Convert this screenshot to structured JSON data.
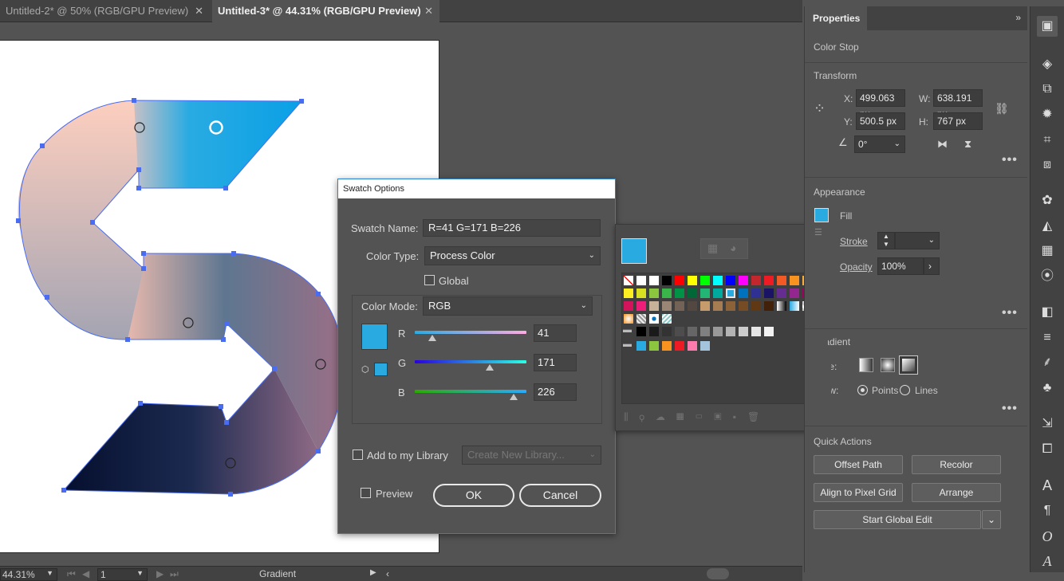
{
  "tabs": [
    {
      "label": "Untitled-2* @ 50% (RGB/GPU Preview)",
      "close": "✕"
    },
    {
      "label": "Untitled-3* @ 44.31% (RGB/GPU Preview)",
      "close": "✕"
    }
  ],
  "status": {
    "zoom": "44.31%",
    "artboard": "1",
    "tool_label": "Gradient"
  },
  "dialog": {
    "title": "Swatch Options",
    "swatch_name_label": "Swatch Name:",
    "swatch_name_value": "R=41 G=171 B=226",
    "color_type_label": "Color Type:",
    "color_type_value": "Process Color",
    "global_label": "Global",
    "color_mode_label": "Color Mode:",
    "color_mode_value": "RGB",
    "r_label": "R",
    "g_label": "G",
    "b_label": "B",
    "r_value": "41",
    "g_value": "171",
    "b_value": "226",
    "add_library_label": "Add to my Library",
    "library_placeholder": "Create New Library...",
    "preview_label": "Preview",
    "ok_label": "OK",
    "cancel_label": "Cancel",
    "swatch_color": "#29abe2"
  },
  "properties": {
    "tab_label": "Properties",
    "context": "Color Stop",
    "transform": {
      "title": "Transform",
      "x_label": "X:",
      "x_value": "499.063 px",
      "y_label": "Y:",
      "y_value": "500.5 px",
      "w_label": "W:",
      "w_value": "638.191 px",
      "h_label": "H:",
      "h_value": "767 px",
      "angle_value": "0°"
    },
    "appearance": {
      "title": "Appearance",
      "fill_label": "Fill",
      "stroke_label": "Stroke",
      "opacity_label": "Opacity",
      "opacity_value": "100%"
    },
    "gradient": {
      "title": "Gradient",
      "type_label": "Type:",
      "draw_label": "Draw:",
      "points_label": "Points",
      "lines_label": "Lines"
    },
    "quick_actions": {
      "title": "Quick Actions",
      "offset_path": "Offset Path",
      "recolor": "Recolor",
      "align_pixel": "Align to Pixel Grid",
      "arrange": "Arrange",
      "global_edit": "Start Global Edit"
    }
  },
  "icons": [
    "properties-icon",
    "layers-icon",
    "libraries-icon",
    "appearance-icon",
    "transform-icon",
    "pathfinder-icon",
    "color-guide-icon",
    "color-icon",
    "swatches-icon",
    "recolor-icon",
    "gradient-icon",
    "stroke-icon",
    "brushes-icon",
    "symbols-icon",
    "asset-export-icon",
    "artboards-icon",
    "character-icon",
    "paragraph-icon",
    "opentype-icon",
    "glyphs-icon"
  ],
  "swatch_grid_colors": [
    [
      "#ffffff",
      "#000000",
      "#ff0000",
      "#ffff00",
      "#00ff00",
      "#00ffff",
      "#0000ff",
      "#ff00ff",
      "#c1272d",
      "#ed1c24",
      "#f15a24",
      "#f7931e",
      "#fbb03b"
    ],
    [
      "#fcee21",
      "#d9e021",
      "#8cc63f",
      "#39b54a",
      "#009245",
      "#006837",
      "#22b573",
      "#00a99d",
      "#29abe2",
      "#0071bc",
      "#2e3192",
      "#1b1464",
      "#662d91",
      "#93278f",
      "#9e005d"
    ],
    [
      "#d4145a",
      "#ed1e79",
      "#c7b299",
      "#998675",
      "#736357",
      "#534741",
      "#c69c6d",
      "#a67c52",
      "#8c6239",
      "#754c24",
      "#603813",
      "#42210b"
    ],
    [
      "#000000",
      "#1a1a1a",
      "#333333",
      "#4d4d4d",
      "#666666",
      "#808080",
      "#999999",
      "#b3b3b3",
      "#cccccc",
      "#e6e6e6",
      "#f2f2f2"
    ],
    [
      "#29abe2",
      "#8cc63f",
      "#f7931e",
      "#ed1c24",
      "#ff7bac",
      "#a3c4dc"
    ]
  ]
}
